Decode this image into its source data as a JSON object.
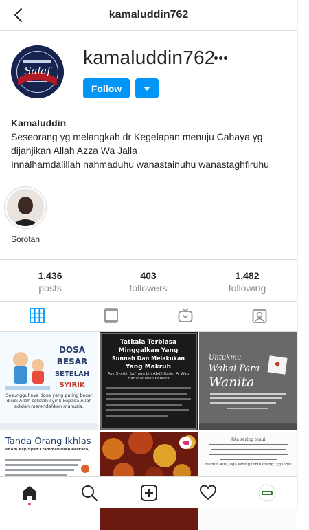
{
  "header": {
    "title": "kamaluddin762"
  },
  "profile": {
    "username": "kamaluddin762",
    "follow_label": "Follow",
    "avatar_text": "Salaf",
    "full_name": "Kamaluddin",
    "bio": [
      "Seseorang yg melangkah dr Kegelapan menuju Cahaya yg",
      "dijanjikan Allah Azza Wa Jalla",
      "Innalhamdalillah nahmaduhu wanastainuhu wanastaghfiruhu"
    ]
  },
  "highlights": [
    {
      "label": "Sorotan"
    }
  ],
  "stats": {
    "posts": {
      "value": "1,436",
      "label": "posts"
    },
    "followers": {
      "value": "403",
      "label": "followers"
    },
    "following": {
      "value": "1,482",
      "label": "following"
    }
  },
  "posts": [
    {
      "lines": [
        "DOSA",
        "BESAR",
        "SETELAH",
        "SYIRIK"
      ],
      "caption": "Sesungguhnya dosa yang paling besar disisi Allah setelah syirik kepada Allah adalah merendahkan manusia."
    },
    {
      "lines": [
        "Tatkala Terbiasa",
        "Minggalkan Yang",
        "Sunnah Dan Melakukan",
        "Yang Makruh"
      ],
      "caption": "Asy Syaikh Ibu'man bin Abdil Karim Al Watr Hafizhahullah berkata"
    },
    {
      "lines": [
        "Untukmu",
        "Wahai Para",
        "Wanita"
      ],
      "caption": ""
    },
    {
      "lines": [
        "Tanda Orang Ikhlas"
      ],
      "caption": "Imam Asy-Syafi'i rahimahullah berkata,"
    },
    {
      "lines": [],
      "caption": ""
    },
    {
      "lines": [
        "Kita sering tenui"
      ],
      "caption": "Namun kita juga sering tenui orang\" yg lebih"
    }
  ],
  "colors": {
    "accent": "#0095f6",
    "text": "#262626",
    "muted": "#8e8e8e",
    "border": "#dbdbdb",
    "notification_dot": "#ed4956"
  },
  "icons": {
    "back": "chevron-left-icon",
    "more": "ellipsis-icon",
    "grid": "grid-icon",
    "feed": "feed-icon",
    "igtv": "igtv-icon",
    "tagged": "tagged-icon",
    "home": "home-icon",
    "search": "search-icon",
    "create": "plus-square-icon",
    "activity": "heart-icon",
    "profile": "profile-avatar-icon"
  }
}
